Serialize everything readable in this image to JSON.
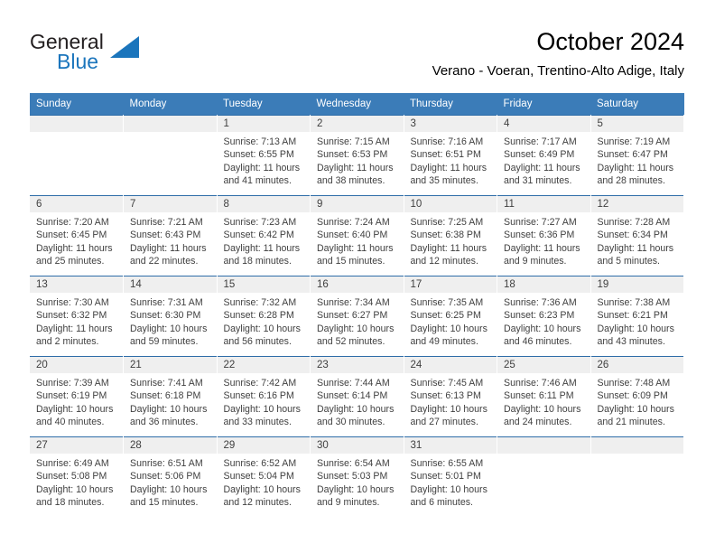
{
  "brand": {
    "name_part1": "General",
    "name_part2": "Blue",
    "logo_icon": "triangle-flag-icon",
    "accent_color": "#1b75bc"
  },
  "header": {
    "title": "October 2024",
    "subtitle": "Verano - Voeran, Trentino-Alto Adige, Italy"
  },
  "theme": {
    "header_blue": "#3b7cb8",
    "rule_blue": "#2f6da8",
    "daynum_band": "#efefef",
    "text": "#3f3f3f"
  },
  "calendar": {
    "weekday_headers": [
      "Sunday",
      "Monday",
      "Tuesday",
      "Wednesday",
      "Thursday",
      "Friday",
      "Saturday"
    ],
    "weeks": [
      [
        {
          "day": "",
          "lines": []
        },
        {
          "day": "",
          "lines": []
        },
        {
          "day": "1",
          "lines": [
            "Sunrise: 7:13 AM",
            "Sunset: 6:55 PM",
            "Daylight: 11 hours",
            "and 41 minutes."
          ]
        },
        {
          "day": "2",
          "lines": [
            "Sunrise: 7:15 AM",
            "Sunset: 6:53 PM",
            "Daylight: 11 hours",
            "and 38 minutes."
          ]
        },
        {
          "day": "3",
          "lines": [
            "Sunrise: 7:16 AM",
            "Sunset: 6:51 PM",
            "Daylight: 11 hours",
            "and 35 minutes."
          ]
        },
        {
          "day": "4",
          "lines": [
            "Sunrise: 7:17 AM",
            "Sunset: 6:49 PM",
            "Daylight: 11 hours",
            "and 31 minutes."
          ]
        },
        {
          "day": "5",
          "lines": [
            "Sunrise: 7:19 AM",
            "Sunset: 6:47 PM",
            "Daylight: 11 hours",
            "and 28 minutes."
          ]
        }
      ],
      [
        {
          "day": "6",
          "lines": [
            "Sunrise: 7:20 AM",
            "Sunset: 6:45 PM",
            "Daylight: 11 hours",
            "and 25 minutes."
          ]
        },
        {
          "day": "7",
          "lines": [
            "Sunrise: 7:21 AM",
            "Sunset: 6:43 PM",
            "Daylight: 11 hours",
            "and 22 minutes."
          ]
        },
        {
          "day": "8",
          "lines": [
            "Sunrise: 7:23 AM",
            "Sunset: 6:42 PM",
            "Daylight: 11 hours",
            "and 18 minutes."
          ]
        },
        {
          "day": "9",
          "lines": [
            "Sunrise: 7:24 AM",
            "Sunset: 6:40 PM",
            "Daylight: 11 hours",
            "and 15 minutes."
          ]
        },
        {
          "day": "10",
          "lines": [
            "Sunrise: 7:25 AM",
            "Sunset: 6:38 PM",
            "Daylight: 11 hours",
            "and 12 minutes."
          ]
        },
        {
          "day": "11",
          "lines": [
            "Sunrise: 7:27 AM",
            "Sunset: 6:36 PM",
            "Daylight: 11 hours",
            "and 9 minutes."
          ]
        },
        {
          "day": "12",
          "lines": [
            "Sunrise: 7:28 AM",
            "Sunset: 6:34 PM",
            "Daylight: 11 hours",
            "and 5 minutes."
          ]
        }
      ],
      [
        {
          "day": "13",
          "lines": [
            "Sunrise: 7:30 AM",
            "Sunset: 6:32 PM",
            "Daylight: 11 hours",
            "and 2 minutes."
          ]
        },
        {
          "day": "14",
          "lines": [
            "Sunrise: 7:31 AM",
            "Sunset: 6:30 PM",
            "Daylight: 10 hours",
            "and 59 minutes."
          ]
        },
        {
          "day": "15",
          "lines": [
            "Sunrise: 7:32 AM",
            "Sunset: 6:28 PM",
            "Daylight: 10 hours",
            "and 56 minutes."
          ]
        },
        {
          "day": "16",
          "lines": [
            "Sunrise: 7:34 AM",
            "Sunset: 6:27 PM",
            "Daylight: 10 hours",
            "and 52 minutes."
          ]
        },
        {
          "day": "17",
          "lines": [
            "Sunrise: 7:35 AM",
            "Sunset: 6:25 PM",
            "Daylight: 10 hours",
            "and 49 minutes."
          ]
        },
        {
          "day": "18",
          "lines": [
            "Sunrise: 7:36 AM",
            "Sunset: 6:23 PM",
            "Daylight: 10 hours",
            "and 46 minutes."
          ]
        },
        {
          "day": "19",
          "lines": [
            "Sunrise: 7:38 AM",
            "Sunset: 6:21 PM",
            "Daylight: 10 hours",
            "and 43 minutes."
          ]
        }
      ],
      [
        {
          "day": "20",
          "lines": [
            "Sunrise: 7:39 AM",
            "Sunset: 6:19 PM",
            "Daylight: 10 hours",
            "and 40 minutes."
          ]
        },
        {
          "day": "21",
          "lines": [
            "Sunrise: 7:41 AM",
            "Sunset: 6:18 PM",
            "Daylight: 10 hours",
            "and 36 minutes."
          ]
        },
        {
          "day": "22",
          "lines": [
            "Sunrise: 7:42 AM",
            "Sunset: 6:16 PM",
            "Daylight: 10 hours",
            "and 33 minutes."
          ]
        },
        {
          "day": "23",
          "lines": [
            "Sunrise: 7:44 AM",
            "Sunset: 6:14 PM",
            "Daylight: 10 hours",
            "and 30 minutes."
          ]
        },
        {
          "day": "24",
          "lines": [
            "Sunrise: 7:45 AM",
            "Sunset: 6:13 PM",
            "Daylight: 10 hours",
            "and 27 minutes."
          ]
        },
        {
          "day": "25",
          "lines": [
            "Sunrise: 7:46 AM",
            "Sunset: 6:11 PM",
            "Daylight: 10 hours",
            "and 24 minutes."
          ]
        },
        {
          "day": "26",
          "lines": [
            "Sunrise: 7:48 AM",
            "Sunset: 6:09 PM",
            "Daylight: 10 hours",
            "and 21 minutes."
          ]
        }
      ],
      [
        {
          "day": "27",
          "lines": [
            "Sunrise: 6:49 AM",
            "Sunset: 5:08 PM",
            "Daylight: 10 hours",
            "and 18 minutes."
          ]
        },
        {
          "day": "28",
          "lines": [
            "Sunrise: 6:51 AM",
            "Sunset: 5:06 PM",
            "Daylight: 10 hours",
            "and 15 minutes."
          ]
        },
        {
          "day": "29",
          "lines": [
            "Sunrise: 6:52 AM",
            "Sunset: 5:04 PM",
            "Daylight: 10 hours",
            "and 12 minutes."
          ]
        },
        {
          "day": "30",
          "lines": [
            "Sunrise: 6:54 AM",
            "Sunset: 5:03 PM",
            "Daylight: 10 hours",
            "and 9 minutes."
          ]
        },
        {
          "day": "31",
          "lines": [
            "Sunrise: 6:55 AM",
            "Sunset: 5:01 PM",
            "Daylight: 10 hours",
            "and 6 minutes."
          ]
        },
        {
          "day": "",
          "lines": []
        },
        {
          "day": "",
          "lines": []
        }
      ]
    ]
  }
}
